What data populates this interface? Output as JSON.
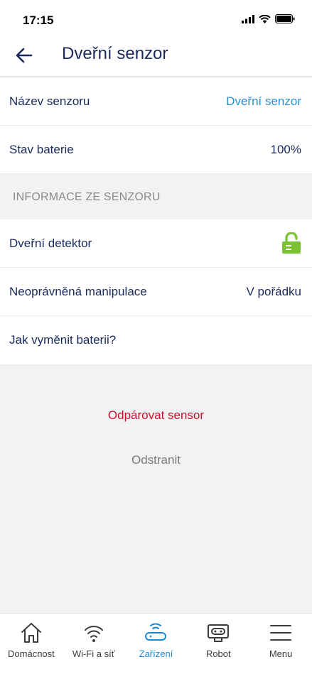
{
  "status_bar": {
    "time": "17:15"
  },
  "header": {
    "title": "Dveřní senzor"
  },
  "rows": {
    "sensor_name": {
      "label": "Název senzoru",
      "value": "Dveřní senzor"
    },
    "battery": {
      "label": "Stav baterie",
      "value": "100%"
    }
  },
  "section": {
    "title": "INFORMACE ZE SENZORU"
  },
  "info_rows": {
    "door_detector": {
      "label": "Dveřní detektor",
      "icon": "unlock-icon",
      "icon_color": "#7ac231"
    },
    "tamper": {
      "label": "Neoprávněná manipulace",
      "value": "V pořádku"
    },
    "battery_help": {
      "label": "Jak vyměnit baterii?"
    }
  },
  "actions": {
    "unpair": "Odpárovat sensor",
    "remove": "Odstranit"
  },
  "tabs": [
    {
      "label": "Domácnost",
      "icon": "home-icon"
    },
    {
      "label": "Wi-Fi a síť",
      "icon": "wifi-icon"
    },
    {
      "label": "Zařízení",
      "icon": "router-icon",
      "active": true
    },
    {
      "label": "Robot",
      "icon": "robot-icon"
    },
    {
      "label": "Menu",
      "icon": "menu-icon"
    }
  ],
  "colors": {
    "primary_text": "#1a2a5c",
    "link": "#2a8fd0",
    "danger": "#c8102e",
    "active_tab": "#1a8ad4",
    "unlock_green": "#7ac231"
  }
}
